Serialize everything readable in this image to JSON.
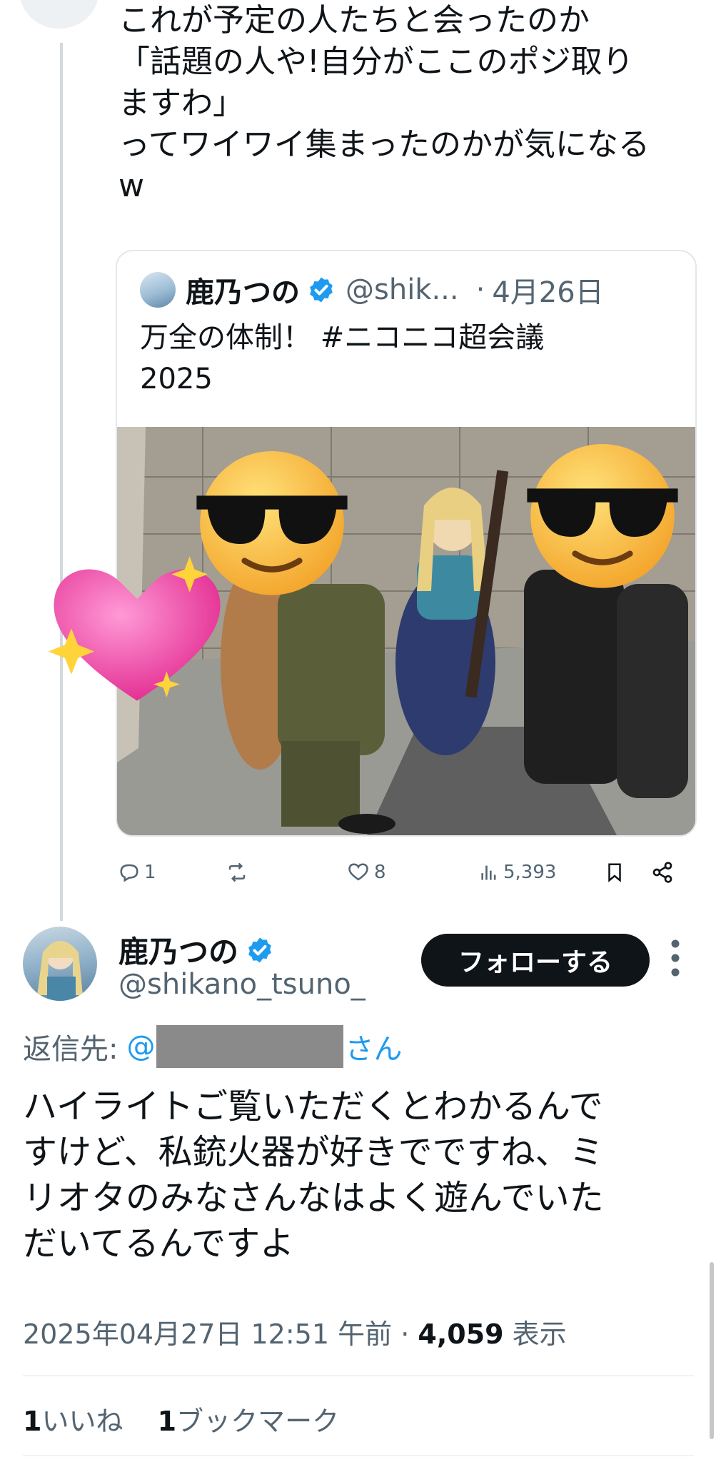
{
  "parent_tweet": {
    "text_lines": [
      "これが予定の人たちと会ったのか",
      "「話題の人や!自分がここのポジ取り",
      "ますわ」",
      "ってワイワイ集まったのかが気になる",
      "w"
    ],
    "quote": {
      "name": "鹿乃つの",
      "handle": "@shik...",
      "separator": "·",
      "date": "4月26日",
      "text_lines": [
        "万全の体制！ #ニコニコ超会議",
        "2025"
      ]
    },
    "actions": {
      "replies": "1",
      "reposts": "",
      "likes": "8",
      "views": "5,393"
    }
  },
  "reply_tweet": {
    "name": "鹿乃つの",
    "handle": "@shikano_tsuno_",
    "follow_label": "フォローする",
    "reply_to_prefix": "返信先:",
    "reply_to_mention_start": "@",
    "reply_to_suffix": "さん",
    "text_lines": [
      "ハイライトご覧いただくとわかるんで",
      "すけど、私銃火器が好きでですね、ミ",
      "リオタのみなさんなはよく遊んでいた",
      "だいてるんですよ"
    ],
    "timestamp": "2025年04月27日 12:51 午前",
    "separator": "·",
    "view_count": "4,059",
    "view_label": "表示",
    "like_count": "1",
    "like_label": "いいね",
    "bookmark_count": "1",
    "bookmark_label": "ブックマーク"
  },
  "colors": {
    "text": "#0f1419",
    "secondary": "#536471",
    "link": "#1d9bf0",
    "verified": "#1d9bf0",
    "follow_bg": "#0f1419"
  },
  "icons": [
    "reply-icon",
    "repost-icon",
    "like-icon",
    "views-icon",
    "bookmark-icon",
    "share-icon",
    "verified-badge-icon",
    "more-icon",
    "sunglasses-emoji",
    "heart-sparkle-emoji"
  ]
}
